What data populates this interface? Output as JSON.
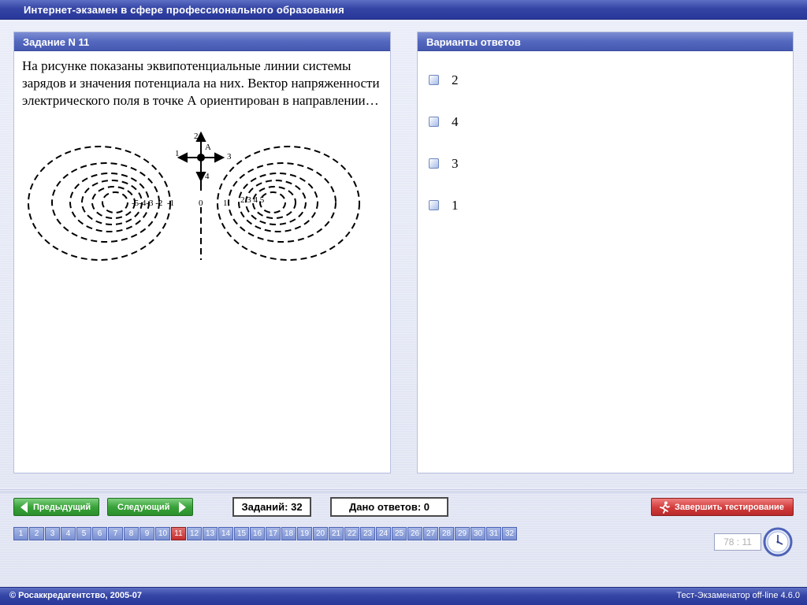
{
  "app": {
    "title": "Интернет-экзамен в сфере профессионального образования"
  },
  "task": {
    "header": "Задание N 11",
    "text": "На рисунке показаны эквипотенциальные линии системы зарядов и значения потенциала на них. Вектор напряженности электрического поля в точке А ориентирован в направлении…",
    "figure": {
      "point_label": "A",
      "direction_labels": [
        "1",
        "2",
        "3",
        "4"
      ],
      "left_potentials": "-5-4-3 -2  -1",
      "zero_label": "0",
      "right_potential_1": "1",
      "right_potentials": "2 3 4 5"
    }
  },
  "answers": {
    "header": "Варианты ответов",
    "options": [
      {
        "label": "2"
      },
      {
        "label": "4"
      },
      {
        "label": "3"
      },
      {
        "label": "1"
      }
    ]
  },
  "nav": {
    "prev_label": "Предыдущий",
    "next_label": "Следующий",
    "tasks_count": "Заданий: 32",
    "answers_given": "Дано ответов: 0",
    "finish_label": "Завершить тестирование",
    "current_question": 11,
    "questions": [
      "1",
      "2",
      "3",
      "4",
      "5",
      "6",
      "7",
      "8",
      "9",
      "10",
      "11",
      "12",
      "13",
      "14",
      "15",
      "16",
      "17",
      "18",
      "19",
      "20",
      "21",
      "22",
      "23",
      "24",
      "25",
      "26",
      "27",
      "28",
      "29",
      "30",
      "31",
      "32"
    ]
  },
  "timer": {
    "value": "78 : 11"
  },
  "footer": {
    "copyright": "© Росаккредагентство, 2005-07",
    "version": "Тест-Экзаменатор off-line 4.6.0"
  },
  "colors": {
    "title_bar": "#3545a5",
    "panel_header": "#5468be",
    "nav_button": "#3aa33a",
    "finish_button": "#d23b3b",
    "current_question": "#c42e2e"
  },
  "icons": {
    "prev": "arrow-left-icon",
    "next": "arrow-right-icon",
    "finish": "running-man-icon",
    "clock": "clock-icon"
  }
}
